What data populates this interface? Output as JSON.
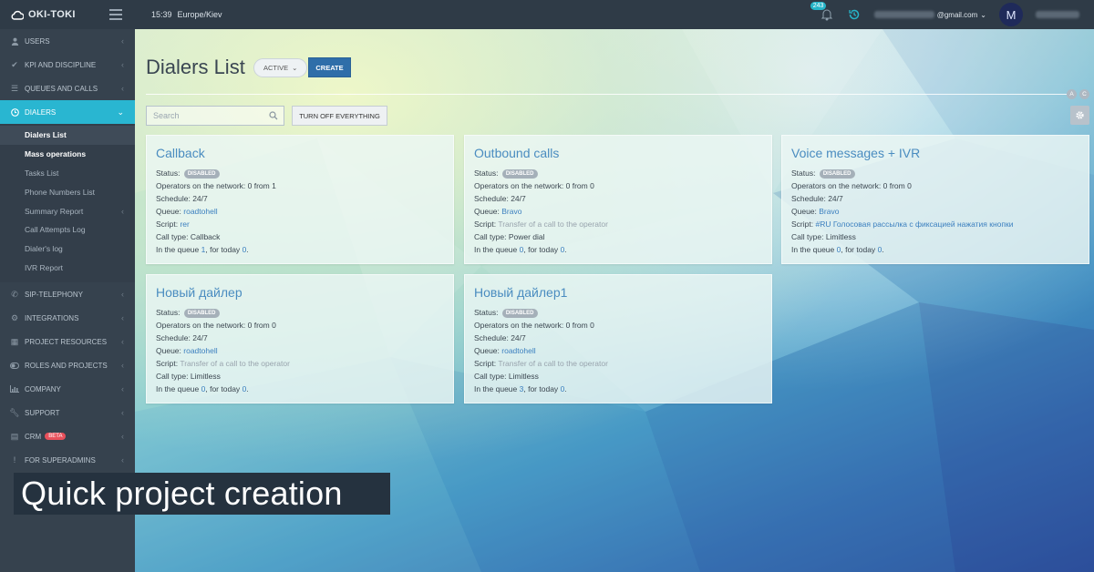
{
  "app": {
    "logo_text": "OKI-TOKI"
  },
  "topbar": {
    "time": "15:39",
    "timezone": "Europe/Kiev",
    "notification_count": "243",
    "email_suffix": "@gmail.com",
    "avatar_initial": "M"
  },
  "sidebar": {
    "items": [
      {
        "label": "USERS",
        "icon": "user-icon"
      },
      {
        "label": "KPI AND DISCIPLINE",
        "icon": "check-icon"
      },
      {
        "label": "QUEUES AND CALLS",
        "icon": "list-icon"
      },
      {
        "label": "DIALERS",
        "icon": "clock-icon"
      },
      {
        "label": "SIP-TELEPHONY",
        "icon": "phone-icon"
      },
      {
        "label": "INTEGRATIONS",
        "icon": "gears-icon"
      },
      {
        "label": "PROJECT RESOURCES",
        "icon": "grid-icon"
      },
      {
        "label": "ROLES AND PROJECTS",
        "icon": "toggle-icon"
      },
      {
        "label": "COMPANY",
        "icon": "bar-chart-icon"
      },
      {
        "label": "SUPPORT",
        "icon": "wrench-icon"
      },
      {
        "label": "CRM",
        "icon": "table-icon",
        "badge": "BETA"
      },
      {
        "label": "FOR SUPERADMINS",
        "icon": "exclamation-icon"
      }
    ],
    "dialer_sub": [
      "Dialers List",
      "Mass operations",
      "Tasks List",
      "Phone Numbers List",
      "Summary Report",
      "Call Attempts Log",
      "Dialer's log",
      "IVR Report"
    ]
  },
  "main": {
    "title": "Dialers List",
    "status_filter": "ACTIVE",
    "create_label": "CREATE",
    "letter_a": "A",
    "letter_c": "C",
    "search_placeholder": "Search",
    "turn_off_label": "TURN OFF EVERYTHING"
  },
  "labels": {
    "status": "Status:",
    "disabled": "DISABLED",
    "operators": "Operators on the network:",
    "schedule": "Schedule:",
    "queue": "Queue:",
    "script": "Script:",
    "call_type": "Call type:",
    "in_queue": "In the queue",
    "for_today": ", for today",
    "period": "."
  },
  "dialers": [
    {
      "name": "Callback",
      "operators": "0 from 1",
      "schedule": "24/7",
      "queue": "roadtohell",
      "script": "rer",
      "script_is_link": true,
      "call_type": "Callback",
      "in_queue": "1",
      "today": "0"
    },
    {
      "name": "Outbound calls",
      "operators": "0 from 0",
      "schedule": "24/7",
      "queue": "Bravo",
      "script": "Transfer of a call to the operator",
      "script_is_link": false,
      "call_type": "Power dial",
      "in_queue": "0",
      "today": "0"
    },
    {
      "name": "Voice messages + IVR",
      "operators": "0 from 0",
      "schedule": "24/7",
      "queue": "Bravo",
      "script": "#RU Голосовая рассылка с фиксацией нажатия кнопки",
      "script_is_link": true,
      "call_type": "Limitless",
      "in_queue": "0",
      "today": "0"
    },
    {
      "name": "Новый дайлер",
      "operators": "0 from 0",
      "schedule": "24/7",
      "queue": "roadtohell",
      "script": "Transfer of a call to the operator",
      "script_is_link": false,
      "call_type": "Limitless",
      "in_queue": "0",
      "today": "0"
    },
    {
      "name": "Новый дайлер1",
      "operators": "0 from 0",
      "schedule": "24/7",
      "queue": "roadtohell",
      "script": "Transfer of a call to the operator",
      "script_is_link": false,
      "call_type": "Limitless",
      "in_queue": "3",
      "today": "0"
    }
  ],
  "caption": "Quick project creation",
  "colors": {
    "accent": "#29b6d1",
    "primary_button": "#2f6ea9",
    "link": "#3b7fbf",
    "sidebar": "#36424e",
    "topbar": "#2f3b47"
  }
}
